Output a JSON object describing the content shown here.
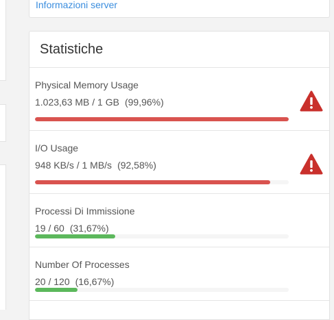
{
  "top_card": {
    "link_text": "Informazioni server"
  },
  "stats_card": {
    "title": "Statistiche"
  },
  "stats": [
    {
      "label": "Physical Memory Usage",
      "value": "1.023,63 MB / 1 GB",
      "percent_text": "(99,96%)",
      "fraction": 0.9996,
      "color": "#d9534f",
      "warning": true,
      "warning_icon": "warning-triangle-icon"
    },
    {
      "label": "I/O Usage",
      "value": "948 KB/s / 1 MB/s",
      "percent_text": "(92,58%)",
      "fraction": 0.9258,
      "color": "#d9534f",
      "warning": true,
      "warning_icon": "warning-triangle-icon"
    },
    {
      "label": "Processi Di Immissione",
      "value": "19 / 60",
      "percent_text": "(31,67%)",
      "fraction": 0.3167,
      "color": "#5cb85c",
      "warning": false
    },
    {
      "label": "Number Of Processes",
      "value": "20 / 120",
      "percent_text": "(16,67%)",
      "fraction": 0.1667,
      "color": "#5cb85c",
      "warning": false
    }
  ]
}
